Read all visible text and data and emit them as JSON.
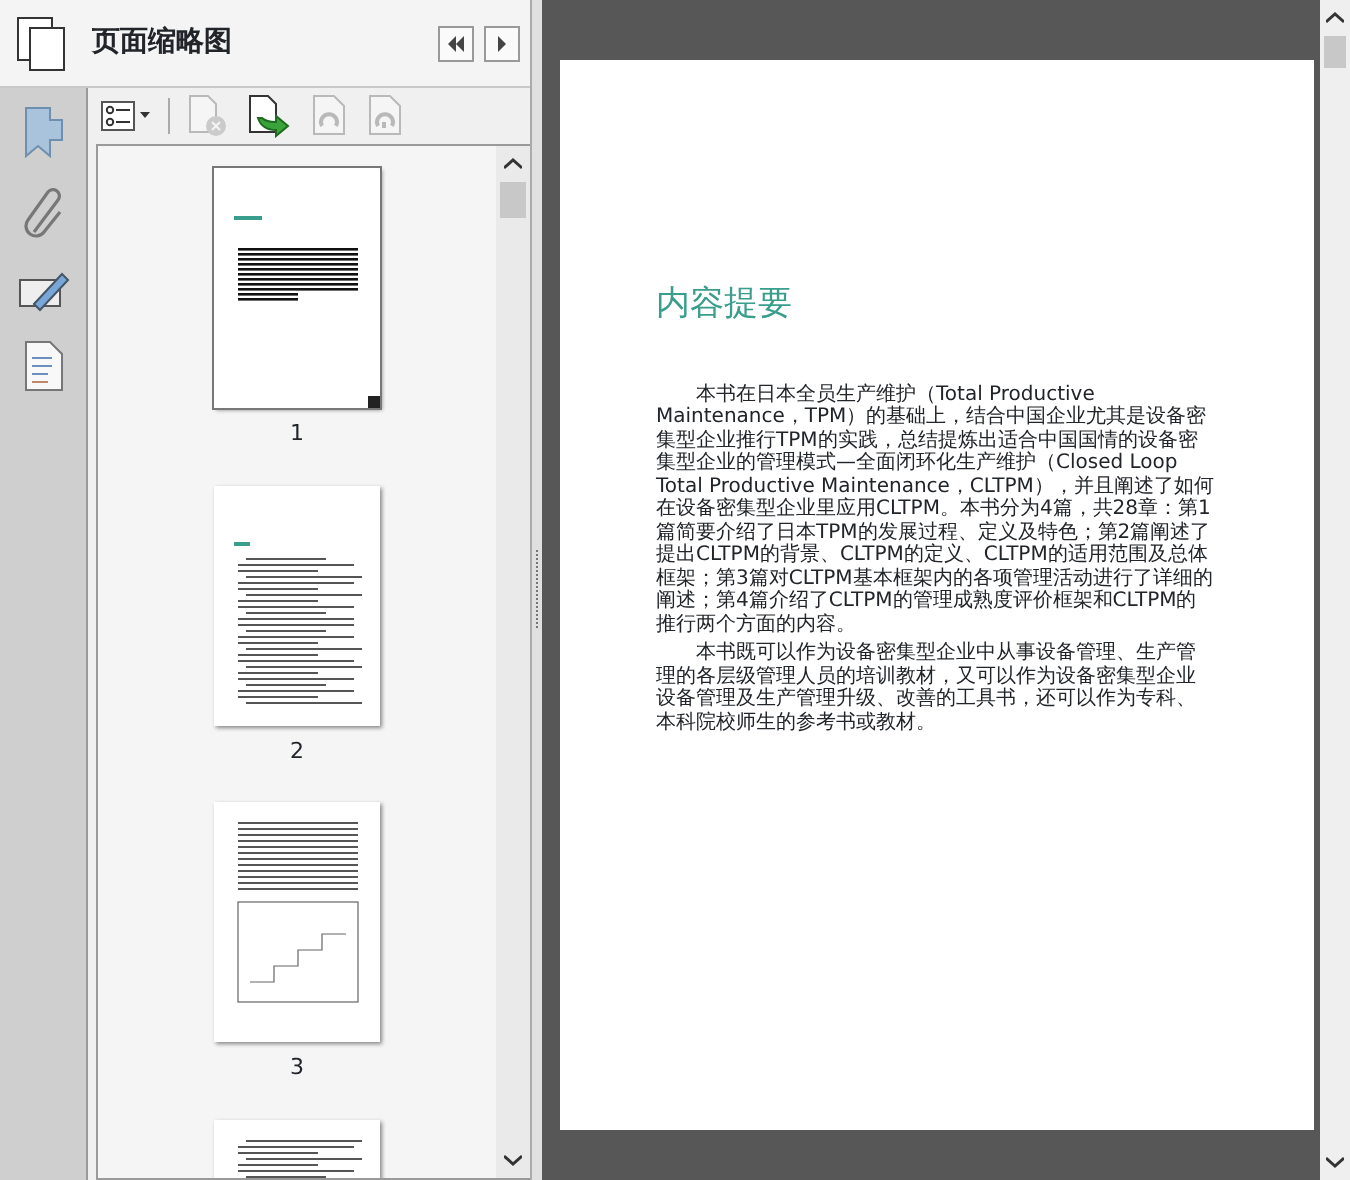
{
  "panel": {
    "title": "页面缩略图"
  },
  "toolbar": [
    {
      "kind": "options",
      "disabled": false
    },
    {
      "kind": "delete",
      "disabled": true
    },
    {
      "kind": "insert",
      "disabled": false
    },
    {
      "kind": "undo",
      "disabled": true
    },
    {
      "kind": "redo",
      "disabled": true
    }
  ],
  "thumbnails": [
    {
      "label": "1",
      "selected": true
    },
    {
      "label": "2",
      "selected": false
    },
    {
      "label": "3",
      "selected": false
    },
    {
      "selected": false
    }
  ],
  "document": {
    "heading": "内容提要",
    "paragraphs": [
      "本书在日本全员生产维护（Total Productive Maintenance，TPM）的基础上，结合中国企业尤其是设备密集型企业推行TPM的实践，总结提炼出适合中国国情的设备密集型企业的管理模式—全面闭环化生产维护（Closed Loop Total Productive Maintenance，CLTPM），并且阐述了如何在设备密集型企业里应用CLTPM。本书分为4篇，共28章：第1篇简要介绍了日本TPM的发展过程、定义及特色；第2篇阐述了提出CLTPM的背景、CLTPM的定义、CLTPM的适用范围及总体框架；第3篇对CLTPM基本框架内的各项管理活动进行了详细的阐述；第4篇介绍了CLTPM的管理成熟度评价框架和CLTPM的推行两个方面的内容。",
      "本书既可以作为设备密集型企业中从事设备管理、生产管理的各层级管理人员的培训教材，又可以作为设备密集型企业设备管理及生产管理升级、改善的工具书，还可以作为专科、本科院校师生的参考书或教材。"
    ]
  }
}
